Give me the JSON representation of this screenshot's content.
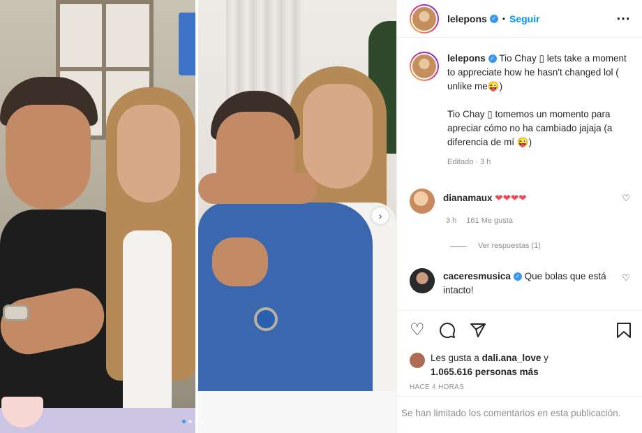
{
  "header": {
    "username": "lelepons",
    "separator": "•",
    "follow_label": "Seguir",
    "more_icon": "⋯"
  },
  "caption": {
    "username": "lelepons",
    "text_en": "Tio Chay ▯ lets take a moment to appreciate how he hasn't changed lol ( unlike me😜)",
    "text_es": "Tio Chay ▯ tomemos un momento para apreciar cómo no ha cambiado jajaja (a diferencia de mí 😜)",
    "meta": "Editado · 3 h"
  },
  "comments": [
    {
      "username": "dianamaux",
      "text": "❤❤❤❤",
      "time": "3 h",
      "likes": "161 Me gusta",
      "replies": "Ver respuestas (1)"
    },
    {
      "username": "caceresmusica",
      "text": "Que bolas que está intacto!"
    }
  ],
  "actions": {
    "like_icon": "heart-icon",
    "comment_icon": "comment-icon",
    "share_icon": "share-icon",
    "save_icon": "bookmark-icon"
  },
  "likes": {
    "prefix": "Les gusta a ",
    "user": "dali.ana_love",
    "middle": " y",
    "count": "1.065.616 personas más"
  },
  "time_ago": "HACE 4 HORAS",
  "comments_limited": "Se han limitado los comentarios en esta publicación.",
  "colors": {
    "accent": "#0095f6",
    "verified": "#3897f0",
    "heart_red": "#ed4956",
    "muted": "#8e8e8e"
  }
}
